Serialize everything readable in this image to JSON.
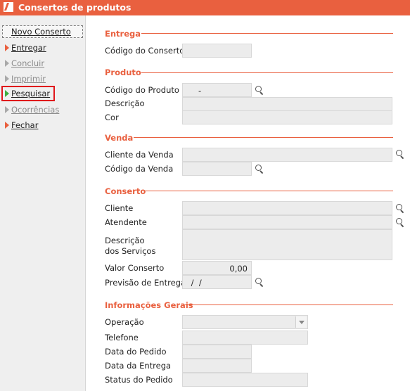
{
  "window": {
    "title": "Consertos de produtos"
  },
  "sidebar": {
    "items": [
      {
        "label": "Novo Conserto"
      },
      {
        "label": "Entregar"
      },
      {
        "label": "Concluir"
      },
      {
        "label": "Imprimir"
      },
      {
        "label": "Pesquisar"
      },
      {
        "label": "Ocorrências"
      },
      {
        "label": "Fechar"
      }
    ]
  },
  "entrega": {
    "title": "Entrega",
    "codigo_conserto_label": "Código do Conserto",
    "codigo_conserto_value": ""
  },
  "produto": {
    "title": "Produto",
    "codigo_label": "Código do Produto",
    "codigo_value": "-",
    "descricao_label": "Descrição",
    "descricao_value": "",
    "cor_label": "Cor",
    "cor_value": ""
  },
  "venda": {
    "title": "Venda",
    "cliente_label": "Cliente da Venda",
    "cliente_value": "",
    "codigo_label": "Código da Venda",
    "codigo_value": ""
  },
  "conserto": {
    "title": "Conserto",
    "cliente_label": "Cliente",
    "cliente_value": "",
    "atendente_label": "Atendente",
    "atendente_value": "",
    "descricao_label_line1": "Descrição",
    "descricao_label_line2": "dos Serviços",
    "descricao_value": "",
    "valor_label": "Valor Conserto",
    "valor_value": "0,00",
    "previsao_label": "Previsão de Entrega",
    "previsao_value": " /  /"
  },
  "informacoes": {
    "title": "Informações Gerais",
    "operacao_label": "Operação",
    "operacao_value": "",
    "telefone_label": "Telefone",
    "telefone_value": "",
    "data_pedido_label": "Data do Pedido",
    "data_pedido_value": "",
    "data_entrega_label": "Data da Entrega",
    "data_entrega_value": "",
    "status_label": "Status do Pedido",
    "status_value": ""
  },
  "colors": {
    "accent": "#e9603f",
    "highlight_border": "#e0161b",
    "field_bg": "#ececec",
    "sidebar_bg": "#efefef"
  },
  "icons": [
    "app-logo-icon",
    "play-arrow-icon",
    "search-icon",
    "chevron-down-icon"
  ]
}
